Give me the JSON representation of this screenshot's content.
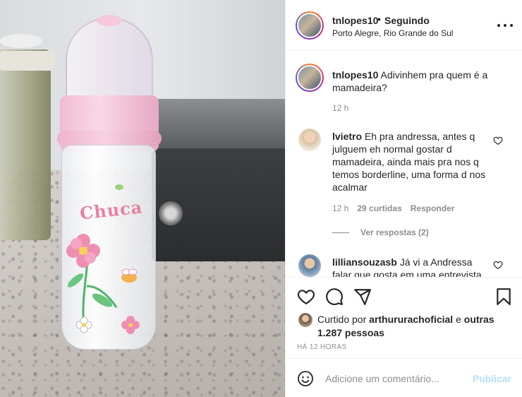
{
  "header": {
    "username": "tnlopes10",
    "separator": "•",
    "follow_status": "Seguindo",
    "location": "Porto Alegre, Rio Grande do Sul",
    "more_icon": "more-horizontal-icon"
  },
  "photo": {
    "bottle_brand": "Chuca"
  },
  "caption": {
    "username": "tnlopes10",
    "text": "Adivinhem pra quem é a mamadeira?",
    "time": "12 h"
  },
  "comments": [
    {
      "username": "lvietro",
      "text": "Eh pra andressa, antes q julguem eh normal gostar d mamadeira, ainda mais pra nos q temos borderline, uma forma d nos acalmar",
      "time": "12 h",
      "likes": "29 curtidas",
      "reply_label": "Responder",
      "view_replies": "Ver respostas (2)"
    },
    {
      "username": "lilliansouzasb",
      "text": "Já vi a Andressa falar que gosta em uma entrevista"
    }
  ],
  "actions": {
    "icons": [
      "heart-icon",
      "comment-icon",
      "share-icon",
      "bookmark-icon"
    ],
    "liked_prefix": "Curtido por",
    "liked_user": "arthururachoficial",
    "liked_and": "e",
    "liked_others": "outras 1.287 pessoas",
    "timestamp": "HÁ 12 HORAS"
  },
  "add_comment": {
    "placeholder": "Adicione um comentário...",
    "publish_label": "Publicar"
  },
  "colors": {
    "text": "#262626",
    "muted": "#8e8e8e",
    "publish_disabled": "#b2dffc",
    "bottle_pink": "#f1bcd2"
  }
}
